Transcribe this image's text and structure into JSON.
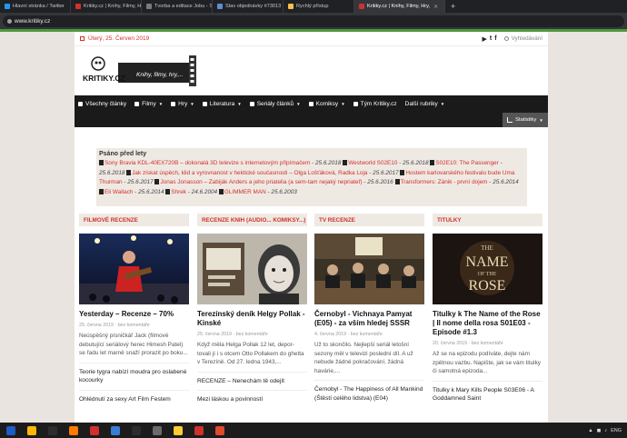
{
  "browser": {
    "tabs": [
      {
        "label": "Hlavní stránka / Twitter",
        "color": "#1d9bf0"
      },
      {
        "label": "Kritiky.cz | Knihy, Filmy, Hry,",
        "color": "#d0312d"
      },
      {
        "label": "Tvorba a editace Jobu - St",
        "color": "#7a7a7a"
      },
      {
        "label": "Stav objednávky #73013",
        "color": "#5a8fd6"
      },
      {
        "label": "Rychlý přístup",
        "color": "#f2c14e"
      },
      {
        "label": "Kritiky.cz | Knihy, Filmy, Hry,",
        "color": "#d0312d"
      }
    ],
    "url": "www.kritiky.cz"
  },
  "header": {
    "date": "Úterý, 25. Červen 2019",
    "social": [
      "▶",
      "t",
      "f"
    ],
    "search_placeholder": "Vyhledávání",
    "logo_text": "KRITIKY.CZ",
    "logo_tagline": "Knihy, filmy, hry,..."
  },
  "nav": {
    "items": [
      {
        "label": "Všechny články",
        "arrow": false
      },
      {
        "label": "Filmy",
        "arrow": true
      },
      {
        "label": "Hry",
        "arrow": true
      },
      {
        "label": "Literatura",
        "arrow": true
      },
      {
        "label": "Seriály článků",
        "arrow": true
      },
      {
        "label": "Komiksy",
        "arrow": true
      },
      {
        "label": "Tým Kritiky.cz",
        "arrow": false
      },
      {
        "label": "Další rubriky",
        "arrow": true
      }
    ],
    "stats_label": "Statistiky"
  },
  "old_posts": {
    "title": "Psáno před lety",
    "items": [
      {
        "title": "Sony Bravia KDL-40EX720B – dokonalá 3D televize s internetovým připímačem",
        "date": "25.6.2018"
      },
      {
        "title": "Westworld S02E10",
        "date": "25.6.2018"
      },
      {
        "title": "S02E10: The Passenger",
        "date": "25.6.2018"
      },
      {
        "title": "Jak získat úspěch, klid a vyrovnanost v hektické současnosti – Olga Lošťáková, Radka Loja",
        "date": "25.6.2017"
      },
      {
        "title": "Hostem karlovarského festivalu bude Uma Thurman",
        "date": "25.6.2017"
      },
      {
        "title": "Jonas Jonasson – Zabiják Anders a jeho priatelia (a sem-tam nejaký nepriateľ)",
        "date": "25.6.2016"
      },
      {
        "title": "Transformers: Zánik - první dojem",
        "date": "25.6.2014"
      },
      {
        "title": "Eli Wallach",
        "date": "25.6.2014"
      },
      {
        "title": "Shrek",
        "date": "24.6.2004"
      },
      {
        "title": "GLIMMER MAN",
        "date": "25.6.2003"
      }
    ]
  },
  "columns": [
    {
      "head": "FILMOVÉ RECENZE",
      "title": "Yesterday – Recenze – 70%",
      "meta": "25. června 2019 · bez komentáře",
      "excerpt": "Neúspěšný písničkář Jack (filmové debutující seriálový herec Himesh Patel) se řadu let marně snaží prorazit po boku...",
      "more1": "Teorie tygra nabízí moudra pro oslabené kocourky",
      "more2": "Ohlédnutí za sexy Art Film Festem"
    },
    {
      "head": "RECENZE KNIH (AUDIO... KOMIKSY...)",
      "title": "Terezínský deník Helgy Pollak - Kinské",
      "meta": "25. června 2019 · bez komentáře",
      "excerpt": "Když měla Helga Pollak 12 let, depor-tovali jí i s otcem Otto Pollakem do ghetta v Terezíně. Od 27. ledna 1943,...",
      "more1": "RECENZE – Nenechám tě odejít",
      "more2": "Mezi láskou a povinností"
    },
    {
      "head": "TV RECENZE",
      "title": "Černobyl - Vichnaya Pamyat (E05) - za vším hledej SSSR",
      "meta": "4. června 2019 · bez komentáře",
      "excerpt": "Už to skončilo. Nejlepší seriál letošní sezony měl v televizi poslední díl. A už nebude žádné pokračování, žádná havárie,...",
      "more1": "Černobyl - The Happiness of All Mankind (Štěstí celého lidstva) (E04)",
      "more2": ""
    },
    {
      "head": "TITULKY",
      "title": "Titulky k The Name of the Rose | Il nome della rosa S01E03 - Episode #1.3",
      "meta": "20. června 2019 · bez komentáře",
      "excerpt": "Až se na epizodu podíváte, dejte nám zpětnou vazbu. Napište, jak se vám titulky či samotná epizoda...",
      "more1": "Titulky k Mary Kills People S03E06 - A Goddamned Saint",
      "more2": ""
    }
  ],
  "thumb4_text": [
    "THE",
    "NAME",
    "OF THE",
    "ROSE"
  ],
  "taskbar": {
    "icons": [
      "#1f5cc4",
      "#ffb900",
      "#2d2d2d",
      "#ff7a00",
      "#d0312d",
      "#3a7bd5",
      "#2d2d2d",
      "#6b6b6b",
      "#ffcc33",
      "#d0312d",
      "#e04a2e"
    ],
    "tray": [
      "▲",
      "◼",
      "♪",
      "ENG"
    ]
  },
  "colors": {
    "accent": "#d0312d",
    "nav_bg": "#1a1a1a",
    "panel_bg": "#efe9e3"
  }
}
